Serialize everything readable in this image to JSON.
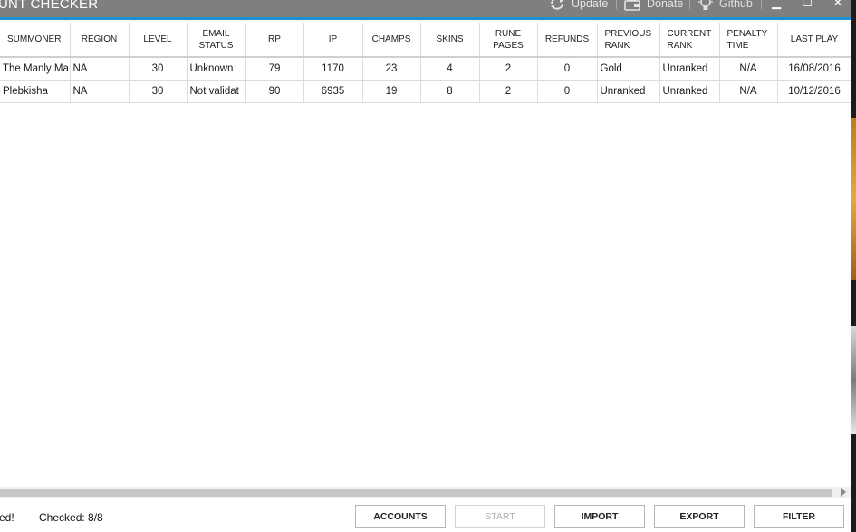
{
  "window": {
    "title": "UNT CHECKER",
    "actions": [
      {
        "label": "Update",
        "icon": "refresh-icon"
      },
      {
        "label": "Donate",
        "icon": "wallet-icon"
      },
      {
        "label": "Github",
        "icon": "bulb-icon"
      }
    ],
    "controls": {
      "minimize": "▁",
      "maximize": "☐",
      "close": "✕"
    }
  },
  "table": {
    "columns": [
      "SUMMONER",
      "REGION",
      "LEVEL",
      "EMAIL STATUS",
      "RP",
      "IP",
      "CHAMPS",
      "SKINS",
      "RUNE PAGES",
      "REFUNDS",
      "PREVIOUS RANK",
      "CURRENT RANK",
      "PENALTY TIME",
      "LAST PLAY"
    ],
    "rows": [
      [
        "The Manly Ma",
        "NA",
        "30",
        "Unknown",
        "79",
        "1170",
        "23",
        "4",
        "2",
        "0",
        "Gold",
        "Unranked",
        "N/A",
        "16/08/2016"
      ],
      [
        "Plebkisha",
        "NA",
        "30",
        "Not validat",
        "90",
        "6935",
        "19",
        "8",
        "2",
        "0",
        "Unranked",
        "Unranked",
        "N/A",
        "10/12/2016"
      ]
    ]
  },
  "status": {
    "message": "ed!",
    "checked": "Checked: 8/8"
  },
  "buttons": {
    "accounts": "ACCOUNTS",
    "start": "START",
    "import": "IMPORT",
    "export": "EXPORT",
    "filter": "FILTER"
  },
  "colors": {
    "titlebar": "#7f7f7f",
    "accent": "#1f8fd1"
  }
}
